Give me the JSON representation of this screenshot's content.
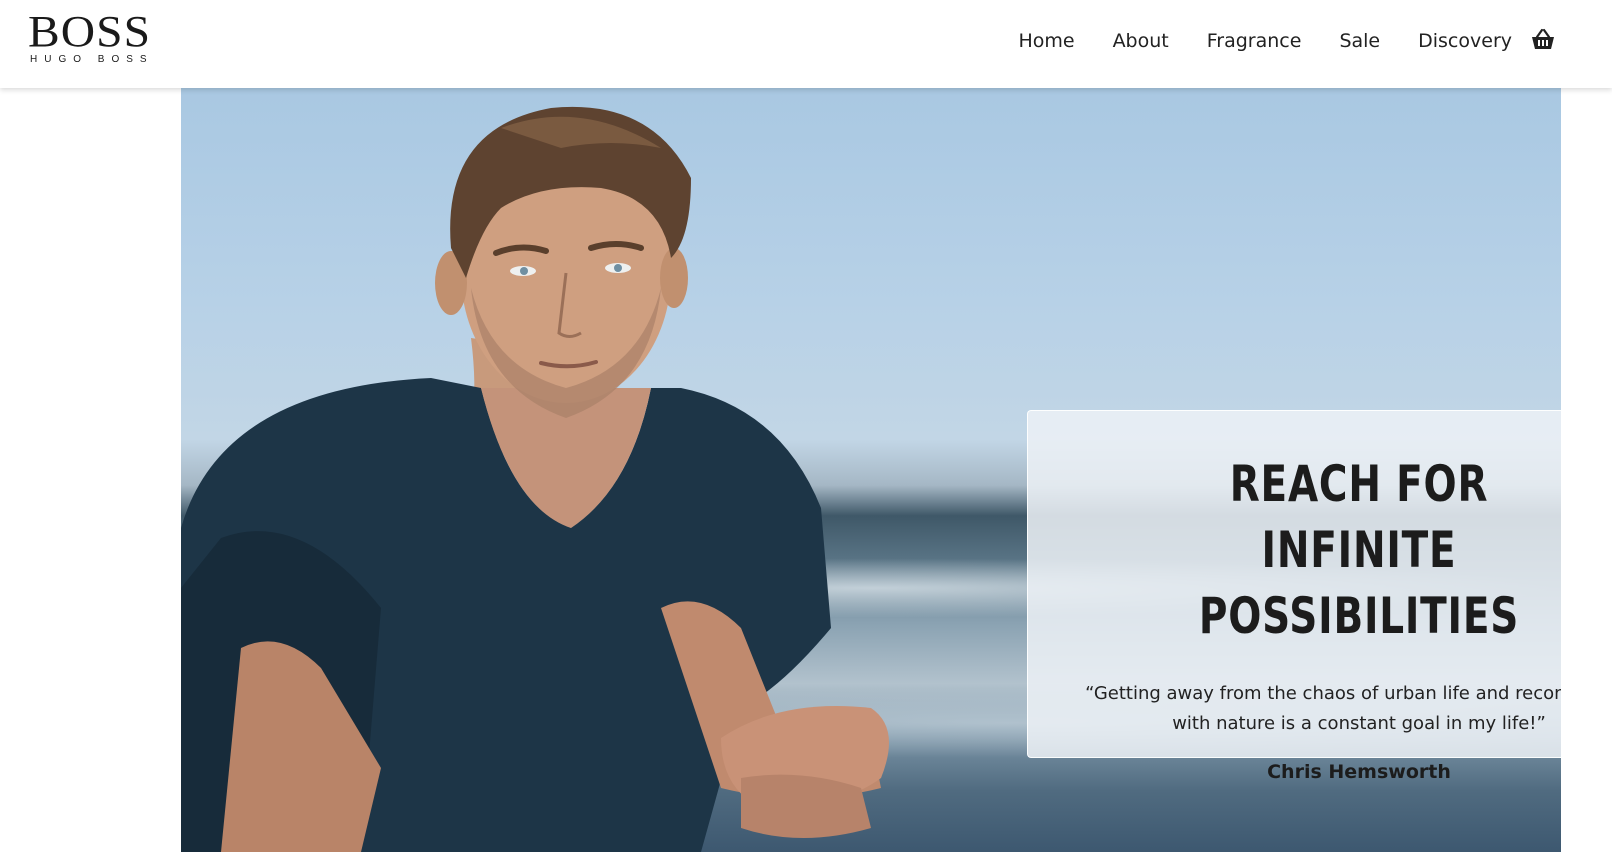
{
  "brand": {
    "logo_main": "BOSS",
    "logo_sub": "HUGO BOSS"
  },
  "nav": {
    "items": [
      {
        "label": "Home"
      },
      {
        "label": "About"
      },
      {
        "label": "Fragrance"
      },
      {
        "label": "Sale"
      },
      {
        "label": "Discovery"
      }
    ],
    "cart_icon": "basket-icon"
  },
  "hero": {
    "title": "REACH FOR INFINITE POSSIBILITIES",
    "quote": "“Getting away from the chaos of urban life and reconnecting with nature is a constant goal in my life!”",
    "author": "Chris Hemsworth"
  },
  "colors": {
    "text": "#222222",
    "header_bg": "#ffffff",
    "sky": "#b7d1e7",
    "sea": "#3f5868",
    "shirt": "#1d3547"
  }
}
